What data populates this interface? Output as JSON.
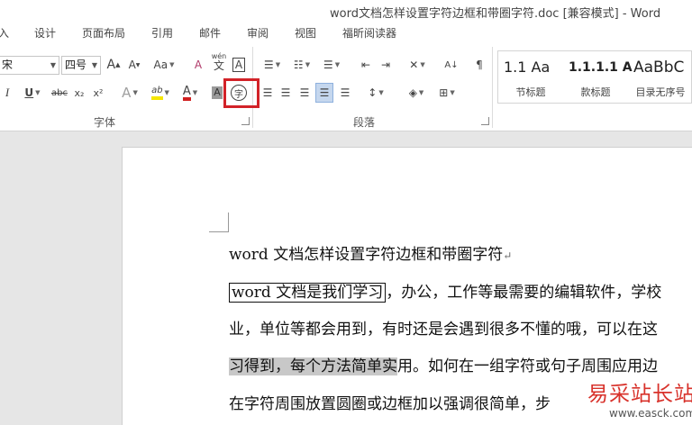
{
  "window": {
    "title": "word文档怎样设置字符边框和带圈字符.doc [兼容模式] - Word"
  },
  "tabs": [
    {
      "label": "入"
    },
    {
      "label": "设计"
    },
    {
      "label": "页面布局"
    },
    {
      "label": "引用"
    },
    {
      "label": "邮件"
    },
    {
      "label": "审阅"
    },
    {
      "label": "视图"
    },
    {
      "label": "福昕阅读器"
    }
  ],
  "ribbon": {
    "font_name": "宋",
    "font_size": "四号",
    "grow_font": "A",
    "shrink_font": "A",
    "change_case": "Aa",
    "clear_format": "A",
    "phonetic_top": "wén",
    "phonetic_bottom": "文",
    "char_border": "A",
    "italic": "I",
    "underline": "U",
    "strikethrough": "abc",
    "subscript": "x₂",
    "superscript": "x²",
    "text_effect": "A",
    "highlight": "ab",
    "font_color": "A",
    "char_shading": "A",
    "enclose_char": "字",
    "sort": "A↓",
    "group_font": "字体",
    "group_paragraph": "段落"
  },
  "styles": [
    {
      "preview": "1.1 Aa",
      "caption": "节标题"
    },
    {
      "preview": "1.1.1.1 A",
      "caption": "款标题"
    },
    {
      "preview": "AaBbC",
      "caption": "目录无序号"
    }
  ],
  "document": {
    "line1": "word 文档怎样设置字符边框和带圈字符",
    "line2_bordered": "word  文档是我们学习",
    "line2_rest": "，办公，工作等最需要的编辑软件，学校",
    "line3": "业，单位等都会用到，有时还是会遇到很多不懂的哦，可以在这",
    "line4_shaded": "习得到，每个方法简单实",
    "line4_rest": "用。如何在一组字符或句子周围应用边",
    "line5": "在字符周围放置圆圈或边框加以强调很简单，步"
  },
  "watermark": {
    "text": "易采站长站",
    "url": "www.easck.com"
  },
  "colors": {
    "accent": "#2b579a",
    "highlight_box": "#d22228",
    "highlight_yellow": "#f5e600",
    "font_red": "#d02020"
  }
}
